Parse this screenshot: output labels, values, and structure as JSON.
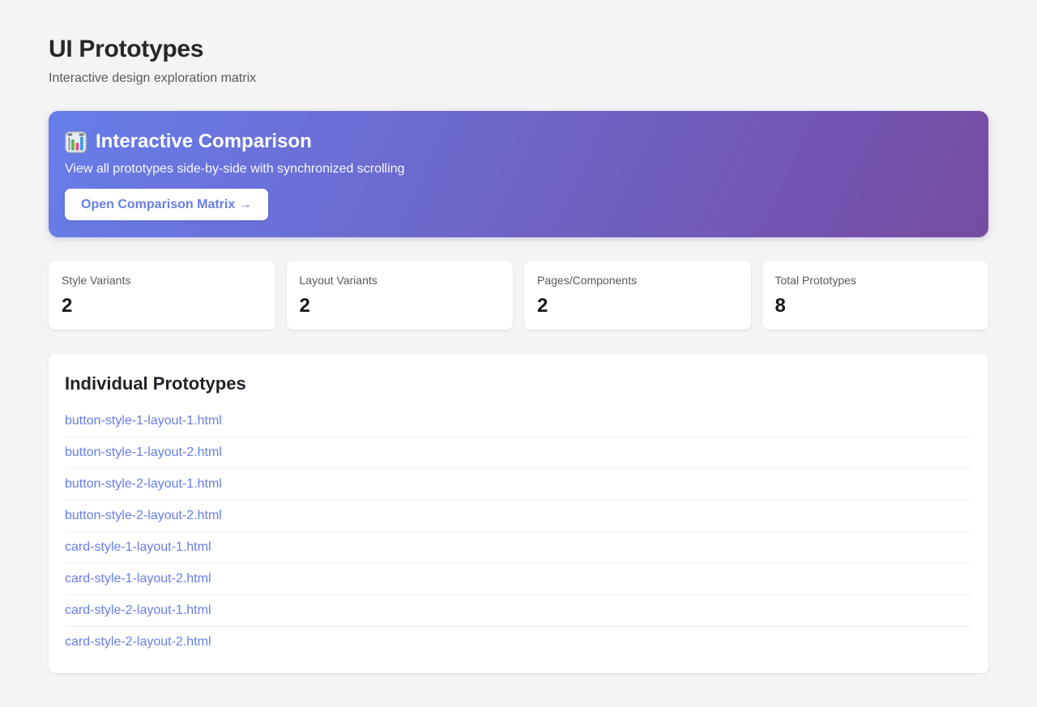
{
  "page": {
    "title": "UI Prototypes",
    "subtitle": "Interactive design exploration matrix"
  },
  "banner": {
    "icon": "bar-chart-icon",
    "title": "Interactive Comparison",
    "description": "View all prototypes side-by-side with synchronized scrolling",
    "button_label": "Open Comparison Matrix →"
  },
  "stats": [
    {
      "label": "Style Variants",
      "value": "2"
    },
    {
      "label": "Layout Variants",
      "value": "2"
    },
    {
      "label": "Pages/Components",
      "value": "2"
    },
    {
      "label": "Total Prototypes",
      "value": "8"
    }
  ],
  "prototypes": {
    "heading": "Individual Prototypes",
    "links": [
      "button-style-1-layout-1.html",
      "button-style-1-layout-2.html",
      "button-style-2-layout-1.html",
      "button-style-2-layout-2.html",
      "card-style-1-layout-1.html",
      "card-style-1-layout-2.html",
      "card-style-2-layout-1.html",
      "card-style-2-layout-2.html"
    ]
  },
  "colors": {
    "accent": "#667eea",
    "gradient_start": "#667eea",
    "gradient_end": "#764ba2",
    "page_background": "#f4f4f5"
  }
}
